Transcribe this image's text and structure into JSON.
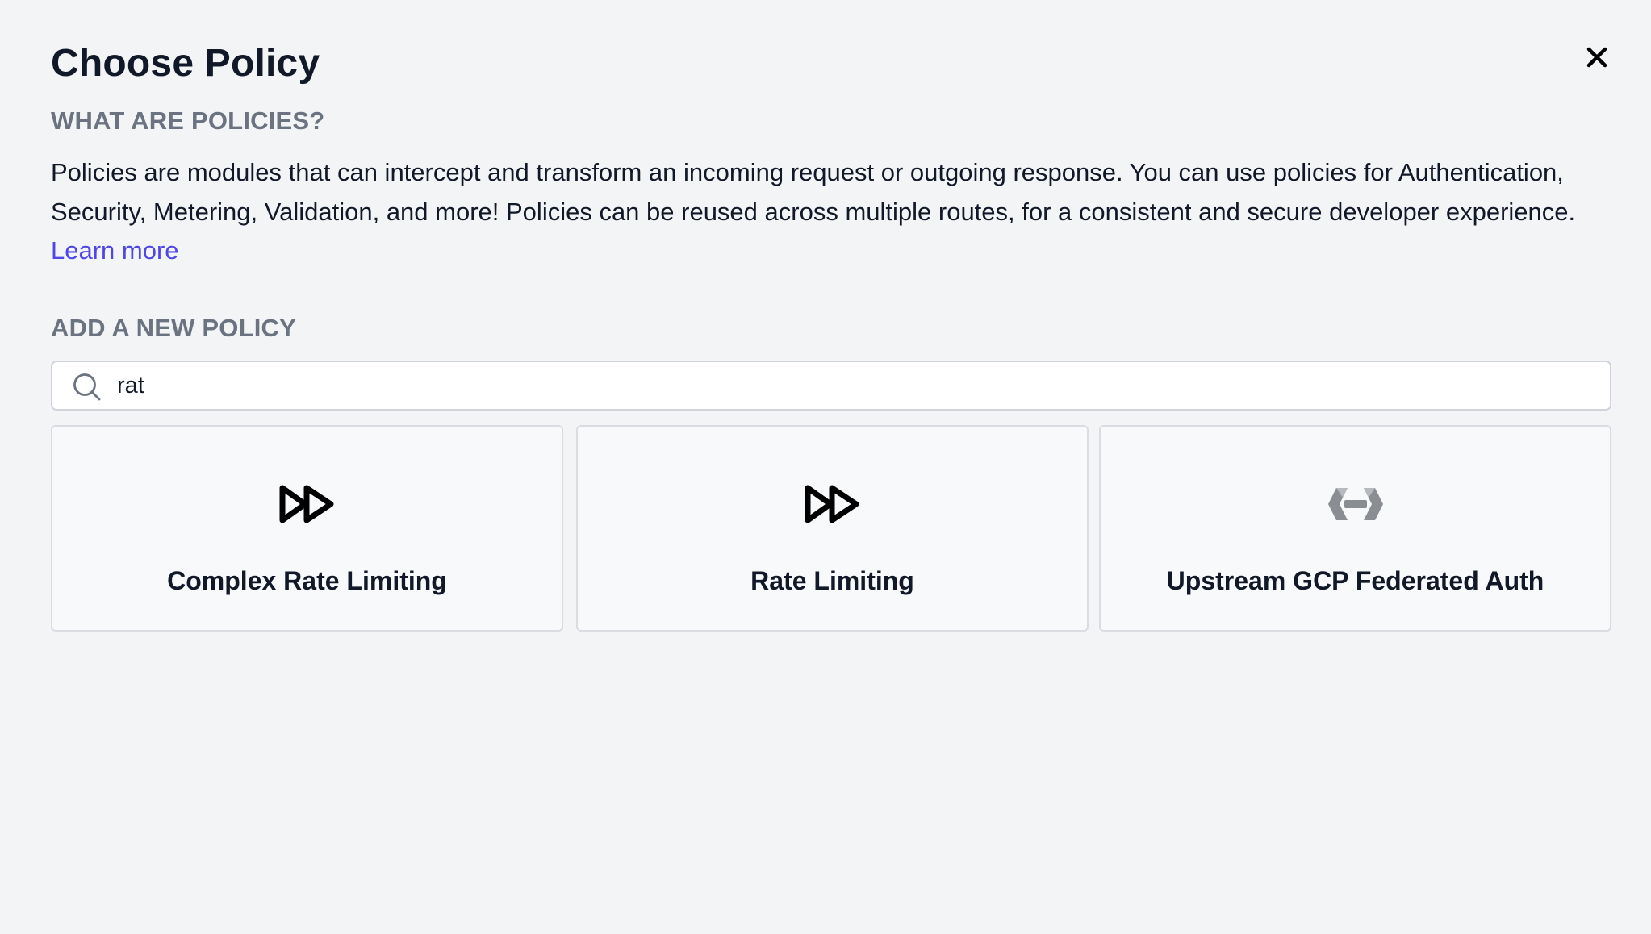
{
  "modal": {
    "title": "Choose Policy",
    "close_icon": "close-icon"
  },
  "about": {
    "heading": "WHAT ARE POLICIES?",
    "description": "Policies are modules that can intercept and transform an incoming request or outgoing response. You can use policies for Authentication, Security, Metering, Validation, and more! Policies can be reused across multiple routes, for a consistent and secure developer experience.",
    "learn_more_label": "Learn more"
  },
  "add_policy": {
    "heading": "ADD A NEW POLICY",
    "search": {
      "icon": "search-icon",
      "value": "rat",
      "placeholder": ""
    },
    "results": [
      {
        "label": "Complex Rate Limiting",
        "icon": "fast-forward-icon"
      },
      {
        "label": "Rate Limiting",
        "icon": "fast-forward-icon"
      },
      {
        "label": "Upstream GCP Federated Auth",
        "icon": "gcp-logo-icon"
      }
    ]
  },
  "colors": {
    "background": "#f2f4f6",
    "link": "#4f46e5",
    "muted_heading": "#6b7280",
    "card_background": "#f8f9fb",
    "card_border": "#d9dce1"
  }
}
